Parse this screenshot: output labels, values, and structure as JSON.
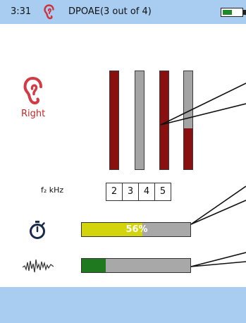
{
  "status_bar": {
    "time": "3:31",
    "title": "DPOAE(3 out of 4)",
    "battery_level": 0.5
  },
  "ear": {
    "label": "Right",
    "color": "#c62828"
  },
  "chart_data": {
    "type": "bar",
    "categories": [
      "2",
      "3",
      "4",
      "5"
    ],
    "values": [
      1.0,
      0.0,
      1.0,
      0.42
    ],
    "ylim": [
      0,
      1
    ]
  },
  "frequency": {
    "label": "f₂ kHz",
    "values": [
      "2",
      "3",
      "4",
      "5"
    ]
  },
  "progress": {
    "test_progress_percent": 56,
    "test_progress_text": "56%",
    "noise_level_percent": 22
  },
  "colors": {
    "accent_blue": "#a8cdf0",
    "bar_response": "#8a0f0f",
    "bar_empty": "#a4a4a4",
    "progress_yellow": "#d4d40c",
    "noise_green": "#1f7a1f"
  },
  "icons": {
    "status_ear": "ear-icon",
    "ear": "ear-icon",
    "timer": "stopwatch-icon",
    "noise": "waveform-icon"
  }
}
